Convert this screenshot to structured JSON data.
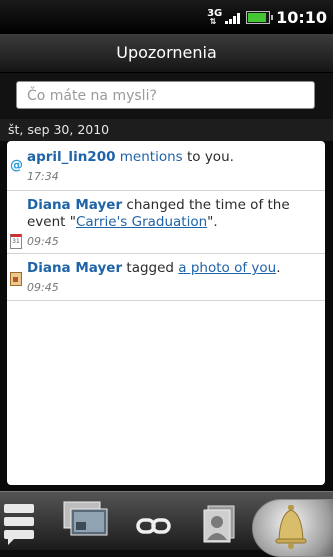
{
  "status_bar": {
    "network": "3G",
    "time": "10:10",
    "signal_icon": "signal-bars",
    "battery_icon": "battery"
  },
  "header": {
    "title": "Upozornenia"
  },
  "compose": {
    "placeholder": "Čo máte na mysli?"
  },
  "date_header": "št, sep 30, 2010",
  "notifications": [
    {
      "icon": "at-icon",
      "user": "april_lin200",
      "action": "mentions",
      "rest": " to you.",
      "time": "17:34"
    },
    {
      "icon": "calendar-icon",
      "user": "Diana Mayer",
      "text": " changed the time of the event \"",
      "link": "Carrie's Graduation",
      "tail": "\".",
      "time": "09:45"
    },
    {
      "icon": "photo-icon",
      "user": "Diana Mayer",
      "text": " tagged ",
      "link": "a photo of you",
      "tail": ".",
      "time": "09:45"
    }
  ],
  "tabs": [
    {
      "name": "status-updates-tab",
      "icon": "speech-bubbles-icon"
    },
    {
      "name": "photos-tab",
      "icon": "photos-icon"
    },
    {
      "name": "links-tab",
      "icon": "link-icon"
    },
    {
      "name": "contacts-tab",
      "icon": "contact-card-icon"
    },
    {
      "name": "notifications-tab",
      "icon": "bell-icon",
      "selected": true
    }
  ]
}
